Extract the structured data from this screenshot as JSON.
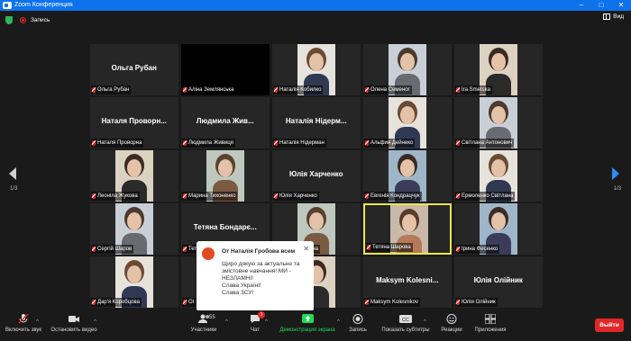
{
  "window": {
    "title": "Zoom Конференция"
  },
  "topbar": {
    "record_label": "Запись",
    "view_label": "Вид"
  },
  "tiles": [
    {
      "display_name": "Ольга Рубан",
      "label": "Ольга Рубан",
      "video": false
    },
    {
      "display_name": "",
      "label": "Аліна Землянська",
      "video": false,
      "black": true
    },
    {
      "display_name": "",
      "label": "Наталія Кобилко",
      "video": true
    },
    {
      "display_name": "",
      "label": "Олена Семеног",
      "video": true
    },
    {
      "display_name": "",
      "label": "Ira Smetska",
      "video": true
    },
    {
      "display_name": "Наталя Проворн...",
      "label": "Наталя Проворна",
      "video": false
    },
    {
      "display_name": "Людмила Жив...",
      "label": "Людмила Живиця",
      "video": false
    },
    {
      "display_name": "Наталія Нідерм...",
      "label": "Наталія Нідерман",
      "video": false
    },
    {
      "display_name": "",
      "label": "Альфия Дейнеко",
      "video": true
    },
    {
      "display_name": "",
      "label": "Світлана Антонович",
      "video": true
    },
    {
      "display_name": "",
      "label": "Леоніла Жукова",
      "video": true
    },
    {
      "display_name": "",
      "label": "Марина Тихоненко",
      "video": true
    },
    {
      "display_name": "Юлія Харченко",
      "label": "Юлія Харченко",
      "video": false
    },
    {
      "display_name": "",
      "label": "Евгенія Кондрацчук",
      "video": true
    },
    {
      "display_name": "",
      "label": "Ермоленко Світлана",
      "video": true
    },
    {
      "display_name": "",
      "label": "Сергій Шаров",
      "video": true
    },
    {
      "display_name": "Тетяна Бондарє...",
      "label": "Тетяна Бондарєва",
      "video": false
    },
    {
      "display_name": "",
      "label": "Ольга Петрівна",
      "video": true
    },
    {
      "display_name": "",
      "label": "Тетяна Шарова",
      "video": true,
      "active": true
    },
    {
      "display_name": "",
      "label": "Ірина Фесенко",
      "video": true
    },
    {
      "display_name": "",
      "label": "Дар'я Коробцова",
      "video": true
    },
    {
      "display_name": "",
      "label": "Ol",
      "video": false
    },
    {
      "display_name": "",
      "label": "Sander",
      "video": true
    },
    {
      "display_name": "Maksym Kolesni...",
      "label": "Maksym Kolesnikov",
      "video": false
    },
    {
      "display_name": "Юлія Олійник",
      "label": "Юлія Олійник",
      "video": false
    }
  ],
  "pagination": {
    "left": "1/3",
    "right": "1/3"
  },
  "chat_toast": {
    "from": "От Наталія Гробова всем",
    "message": "Щиро дякую за актуальне та змістовне навчання! МИ - НЕЗЛАМНІ!\nСлава Україні!\nСлава ЗСУ!"
  },
  "toolbar": {
    "unmute": "Включить звук",
    "video": "Остановить видео",
    "participants": "Участники",
    "participants_count": "55",
    "chat": "Чат",
    "chat_badge": "3",
    "share": "Демонстрация экрана",
    "record": "Запись",
    "captions": "Показать субтитры",
    "reactions": "Реакции",
    "apps": "Приложения",
    "leave": "Выйти"
  },
  "colors": {
    "accent": "#0e72ed",
    "share_green": "#23d959",
    "leave_red": "#e02828",
    "active_border": "#e8e84a"
  }
}
